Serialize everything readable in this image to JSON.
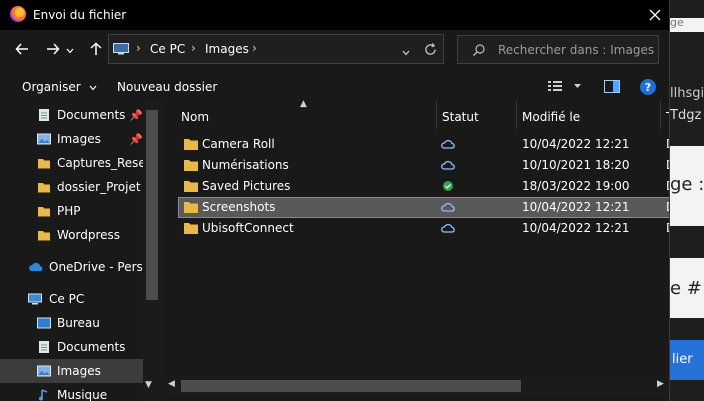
{
  "window": {
    "title": "Envoi du fichier"
  },
  "nav": {
    "back": "back",
    "forward": "forward",
    "up": "up"
  },
  "address": {
    "crumbs": [
      "Ce PC",
      "Images"
    ]
  },
  "search": {
    "placeholder": "Rechercher dans : Images"
  },
  "toolbar": {
    "organise_label": "Organiser",
    "new_folder_label": "Nouveau dossier",
    "help_label": "?"
  },
  "sidebar": {
    "items": [
      {
        "label": "Documents",
        "icon": "documents-icon",
        "pinned": true
      },
      {
        "label": "Images",
        "icon": "images-icon",
        "pinned": true
      },
      {
        "label": "Captures_Reseau",
        "icon": "folder-icon"
      },
      {
        "label": "dossier_Projet",
        "icon": "folder-icon"
      },
      {
        "label": "PHP",
        "icon": "folder-icon"
      },
      {
        "label": "Wordpress",
        "icon": "folder-icon"
      },
      {
        "label": "OneDrive - Persor",
        "icon": "onedrive-icon"
      },
      {
        "label": "Ce PC",
        "icon": "pc-icon"
      },
      {
        "label": "Bureau",
        "icon": "desktop-icon"
      },
      {
        "label": "Documents",
        "icon": "documents-icon"
      },
      {
        "label": "Images",
        "icon": "images-icon",
        "selected": true
      },
      {
        "label": "Musique",
        "icon": "music-icon"
      }
    ]
  },
  "columns": {
    "name": "Nom",
    "status": "Statut",
    "modified": "Modifié le",
    "type": "T"
  },
  "files": [
    {
      "name": "Camera Roll",
      "status": "cloud",
      "modified": "10/04/2022 12:21",
      "type": "D"
    },
    {
      "name": "Numérisations",
      "status": "cloud",
      "modified": "10/10/2021 18:20",
      "type": "D"
    },
    {
      "name": "Saved Pictures",
      "status": "synced",
      "modified": "18/03/2022 19:00",
      "type": "D"
    },
    {
      "name": "Screenshots",
      "status": "cloud",
      "modified": "10/04/2022 12:21",
      "type": "D",
      "selected": true
    },
    {
      "name": "UbisoftConnect",
      "status": "cloud",
      "modified": "10/04/2022 12:21",
      "type": "D"
    }
  ],
  "background_page": {
    "t1": "ge",
    "t2": "llhsgio",
    "t3": "Tdgz",
    "t4": "ge :",
    "t5": "e #",
    "button": "lier"
  },
  "colors": {
    "accent": "#1f6fd6",
    "folder": "#e8b84a",
    "cloud": "#8fc2ff",
    "synced": "#2ea44f"
  }
}
